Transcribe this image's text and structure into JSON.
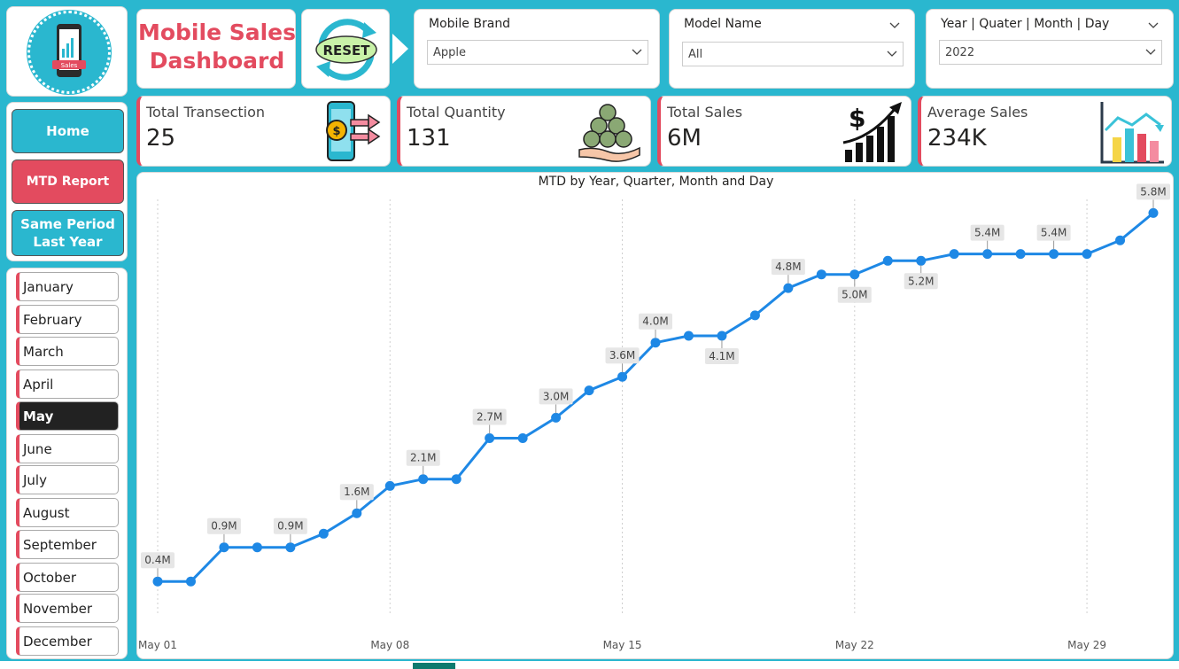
{
  "logo": {
    "badge_text": "Sales",
    "icon": "phone-chart-icon"
  },
  "nav": {
    "home": "Home",
    "mtd": "MTD Report",
    "same_period_line1": "Same Period",
    "same_period_line2": "Last Year"
  },
  "months": [
    "January",
    "February",
    "March",
    "April",
    "May",
    "June",
    "July",
    "August",
    "September",
    "October",
    "November",
    "December"
  ],
  "selected_month": "May",
  "title": {
    "line1": "Mobile Sales",
    "line2": "Dashboard"
  },
  "reset": {
    "label": "RESET"
  },
  "filters": {
    "brand": {
      "label": "Mobile Brand",
      "value": "Apple"
    },
    "model": {
      "label": "Model Name",
      "value": "All"
    },
    "date": {
      "label": "Year | Quater | Month | Day",
      "value": "2022"
    }
  },
  "kpis": [
    {
      "label": "Total Transection",
      "value": "25",
      "icon": "payment-transfer-icon"
    },
    {
      "label": "Total Quantity",
      "value": "131",
      "icon": "coins-hand-icon"
    },
    {
      "label": "Total Sales",
      "value": "6M",
      "icon": "dollar-growth-icon"
    },
    {
      "label": "Average Sales",
      "value": "234K",
      "icon": "bar-chart-trend-icon"
    }
  ],
  "colors": {
    "accent": "#e34b5f",
    "teal": "#2ab7cf",
    "line": "#1e88e5"
  },
  "chart_data": {
    "type": "line",
    "title": "MTD by Year, Quarter, Month and Day",
    "x_ticks": [
      "May 01",
      "May 08",
      "May 15",
      "May 22",
      "May 29"
    ],
    "x": [
      1,
      2,
      3,
      4,
      5,
      6,
      7,
      8,
      9,
      10,
      11,
      12,
      13,
      14,
      15,
      16,
      17,
      18,
      19,
      20,
      21,
      22,
      23,
      24,
      25,
      26,
      27,
      28,
      29,
      30,
      31
    ],
    "y": [
      0.4,
      0.4,
      0.9,
      0.9,
      0.9,
      1.1,
      1.4,
      1.8,
      1.9,
      1.9,
      2.5,
      2.5,
      2.8,
      3.2,
      3.4,
      3.9,
      4.0,
      4.0,
      4.3,
      4.7,
      4.9,
      4.9,
      5.1,
      5.1,
      5.2,
      5.2,
      5.2,
      5.2,
      5.2,
      5.4,
      5.8
    ],
    "data_labels": [
      {
        "x": 1,
        "text": "0.4M",
        "pos": "above"
      },
      {
        "x": 3,
        "text": "0.9M",
        "pos": "above"
      },
      {
        "x": 5,
        "text": "0.9M",
        "pos": "above"
      },
      {
        "x": 7,
        "text": "1.6M",
        "pos": "above"
      },
      {
        "x": 9,
        "text": "2.1M",
        "pos": "above"
      },
      {
        "x": 11,
        "text": "2.7M",
        "pos": "above"
      },
      {
        "x": 13,
        "text": "3.0M",
        "pos": "above"
      },
      {
        "x": 15,
        "text": "3.6M",
        "pos": "above"
      },
      {
        "x": 16,
        "text": "4.0M",
        "pos": "above"
      },
      {
        "x": 18,
        "text": "4.1M",
        "pos": "below"
      },
      {
        "x": 20,
        "text": "4.8M",
        "pos": "above"
      },
      {
        "x": 22,
        "text": "5.0M",
        "pos": "below"
      },
      {
        "x": 24,
        "text": "5.2M",
        "pos": "below"
      },
      {
        "x": 26,
        "text": "5.4M",
        "pos": "above"
      },
      {
        "x": 28,
        "text": "5.4M",
        "pos": "above"
      },
      {
        "x": 31,
        "text": "5.8M",
        "pos": "above"
      }
    ],
    "xlabel": "",
    "ylabel": "",
    "ylim": [
      0,
      6
    ],
    "grid": "vertical-dotted"
  }
}
